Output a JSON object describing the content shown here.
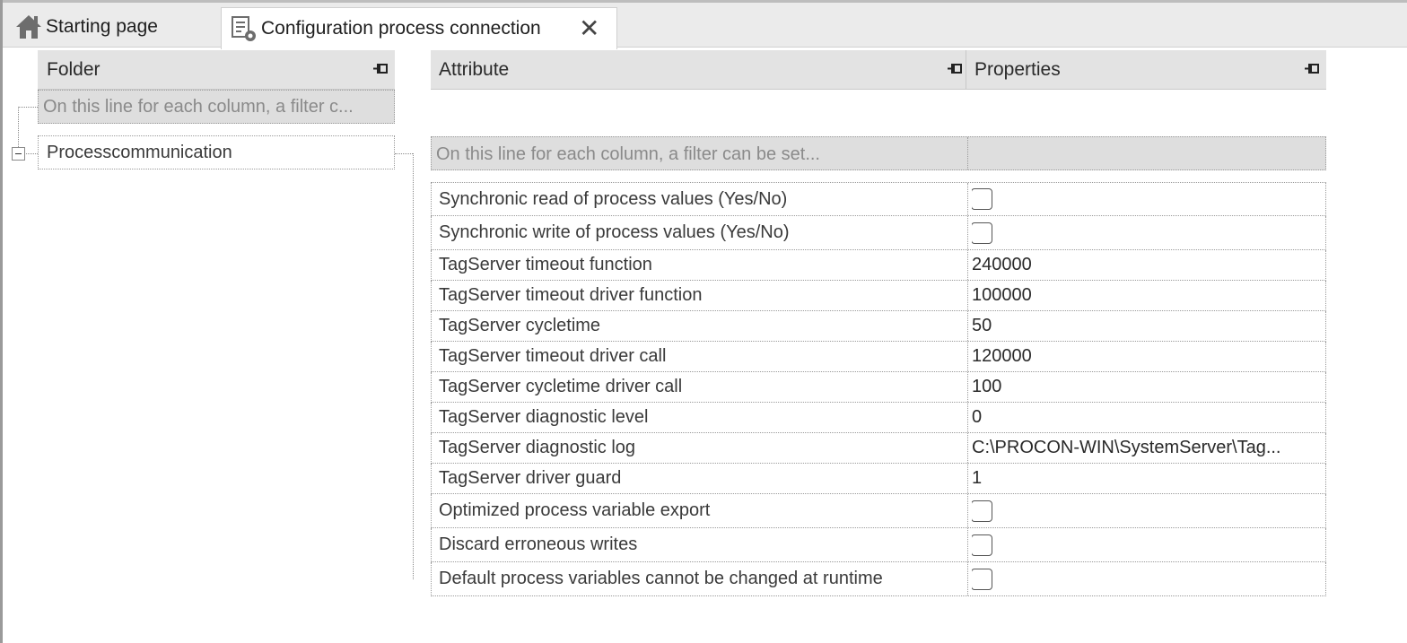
{
  "tabs": [
    {
      "label": "Starting page",
      "icon": "home-icon"
    },
    {
      "label": "Configuration process connection",
      "icon": "config-list-gear-icon",
      "close_icon": "close-icon"
    }
  ],
  "folder_panel": {
    "header": "Folder",
    "pin_icon": "pin-icon",
    "filter_placeholder": "On this line for each column, a filter c...",
    "items": [
      {
        "label": "Processcommunication",
        "expander": "collapse-icon"
      }
    ]
  },
  "grid": {
    "columns": [
      "Attribute",
      "Properties"
    ],
    "pin_icon": "pin-icon",
    "filter_placeholder": "On this line for each column, a filter can be set...",
    "rows": [
      {
        "attribute": "Synchronic read of process values (Yes/No)",
        "type": "checkbox",
        "checked": false
      },
      {
        "attribute": "Synchronic write of process values (Yes/No)",
        "type": "checkbox",
        "checked": false
      },
      {
        "attribute": "TagServer timeout function",
        "type": "text",
        "value": "240000"
      },
      {
        "attribute": "TagServer timeout driver function",
        "type": "text",
        "value": "100000"
      },
      {
        "attribute": "TagServer cycletime",
        "type": "text",
        "value": "50"
      },
      {
        "attribute": "TagServer timeout driver call",
        "type": "text",
        "value": "120000"
      },
      {
        "attribute": "TagServer cycletime driver call",
        "type": "text",
        "value": "100"
      },
      {
        "attribute": "TagServer diagnostic level",
        "type": "text",
        "value": "0"
      },
      {
        "attribute": "TagServer diagnostic log",
        "type": "text",
        "value": "C:\\PROCON-WIN\\SystemServer\\Tag..."
      },
      {
        "attribute": "TagServer driver guard",
        "type": "text",
        "value": "1"
      },
      {
        "attribute": "Optimized process variable export",
        "type": "checkbox",
        "checked": false
      },
      {
        "attribute": "Discard erroneous writes",
        "type": "checkbox",
        "checked": false
      },
      {
        "attribute": "Default process variables cannot be changed at runtime",
        "type": "checkbox",
        "checked": false
      }
    ]
  }
}
